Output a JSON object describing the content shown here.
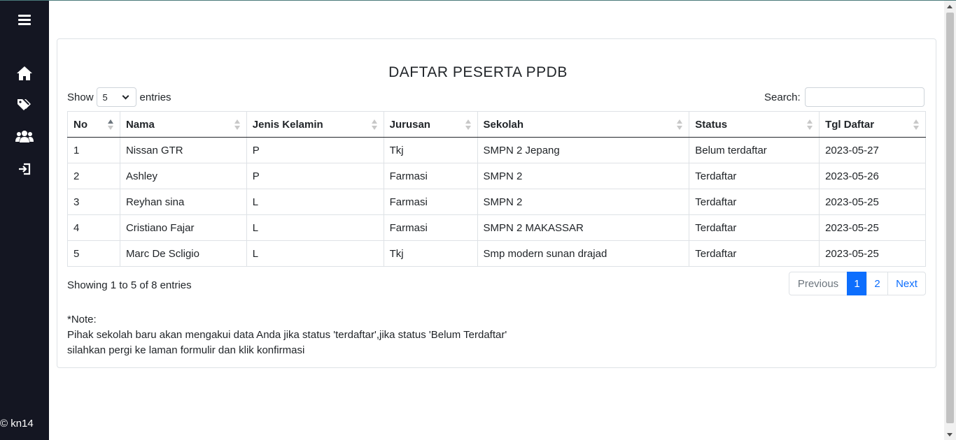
{
  "sidebar": {
    "icons": [
      "menu-icon",
      "home-icon",
      "tag-icon",
      "users-icon",
      "logout-icon"
    ],
    "footer": "© kn14"
  },
  "page": {
    "title": "DAFTAR PESERTA PPDB"
  },
  "length_control": {
    "prefix": "Show",
    "selected": "5",
    "suffix": "entries"
  },
  "search": {
    "label": "Search:",
    "value": ""
  },
  "table": {
    "headers": [
      "No",
      "Nama",
      "Jenis Kelamin",
      "Jurusan",
      "Sekolah",
      "Status",
      "Tgl Daftar"
    ],
    "rows": [
      [
        "1",
        "Nissan GTR",
        "P",
        "Tkj",
        "SMPN 2 Jepang",
        "Belum terdaftar",
        "2023-05-27"
      ],
      [
        "2",
        "Ashley",
        "P",
        "Farmasi",
        "SMPN 2",
        "Terdaftar",
        "2023-05-26"
      ],
      [
        "3",
        "Reyhan sina",
        "L",
        "Farmasi",
        "SMPN 2",
        "Terdaftar",
        "2023-05-25"
      ],
      [
        "4",
        "Cristiano Fajar",
        "L",
        "Farmasi",
        "SMPN 2 MAKASSAR",
        "Terdaftar",
        "2023-05-25"
      ],
      [
        "5",
        "Marc De Scligio",
        "L",
        "Tkj",
        "Smp modern sunan drajad",
        "Terdaftar",
        "2023-05-25"
      ]
    ]
  },
  "info": "Showing 1 to 5 of 8 entries",
  "pagination": {
    "previous": "Previous",
    "pages": [
      "1",
      "2"
    ],
    "current": "1",
    "next": "Next"
  },
  "note": {
    "heading": "*Note:",
    "line1": "Pihak sekolah baru akan mengakui data Anda jika status 'terdaftar',jika status 'Belum Terdaftar'",
    "line2": "silahkan pergi ke laman formulir dan klik konfirmasi"
  },
  "colors": {
    "sidebar_bg": "#141622",
    "primary": "#0d6efd"
  }
}
